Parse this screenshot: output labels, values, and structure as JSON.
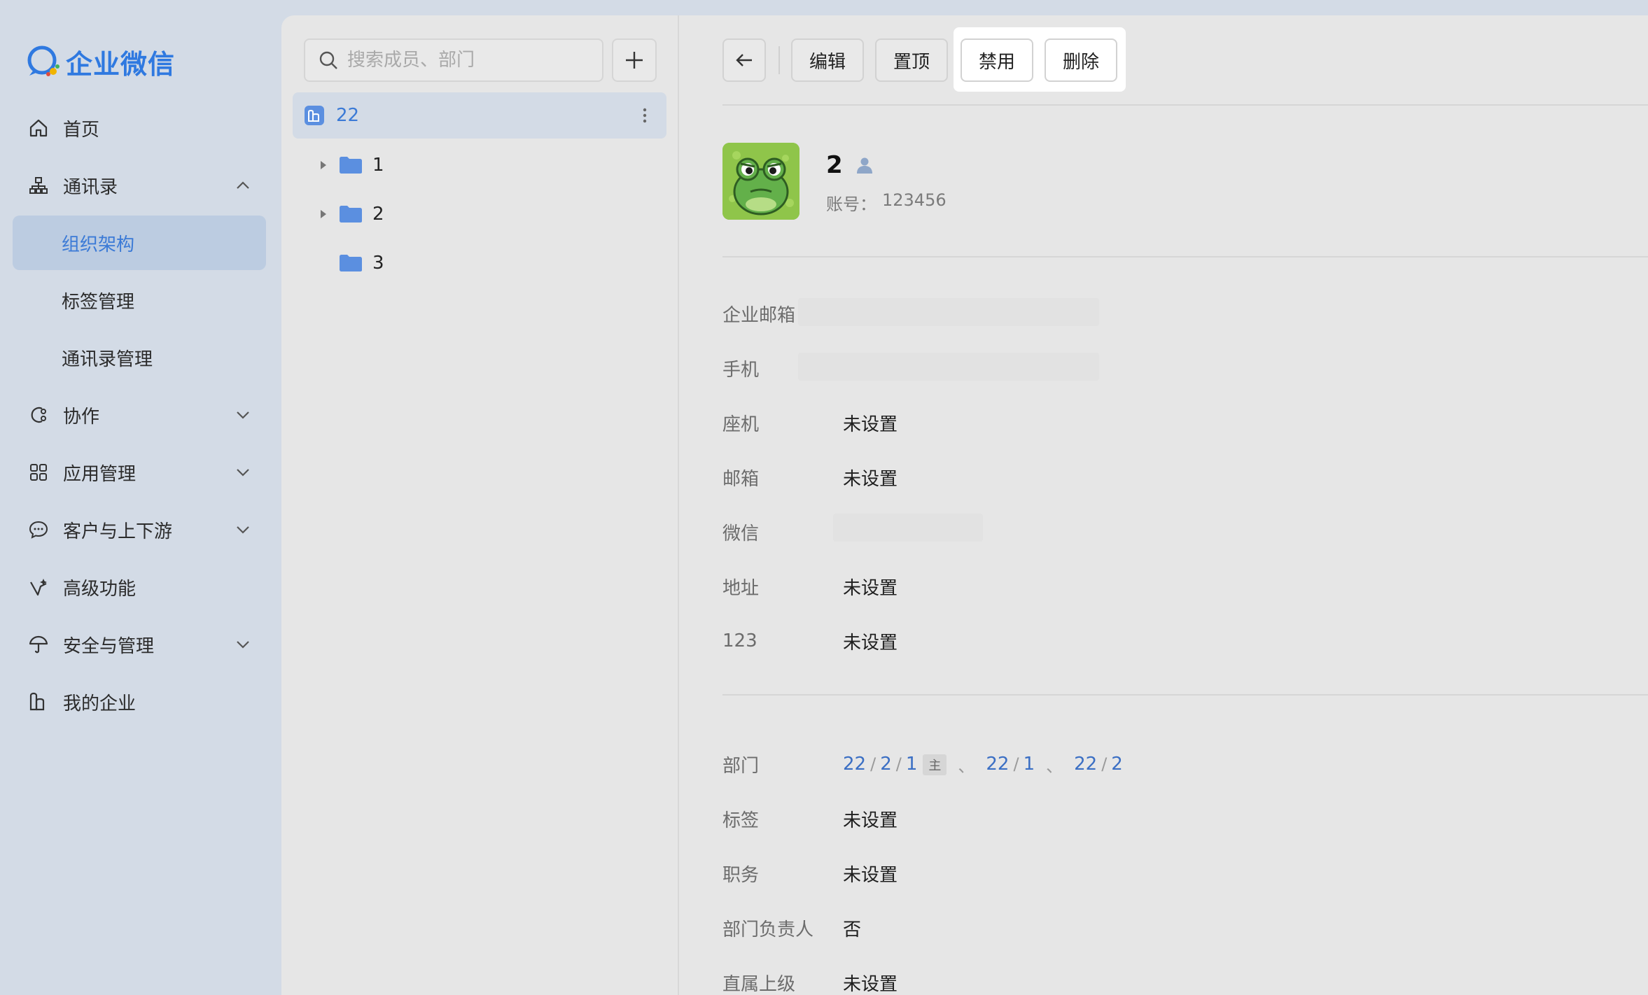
{
  "app": {
    "brand": "企业微信",
    "brand_color": "#2f79e0",
    "accent_color": "#3b7ad6"
  },
  "nav": {
    "home": "首页",
    "contacts": "通讯录",
    "contacts_sub": {
      "org": "组织架构",
      "tags": "标签管理",
      "manage": "通讯录管理"
    },
    "collab": "协作",
    "apps": "应用管理",
    "customers": "客户与上下游",
    "advanced": "高级功能",
    "security": "安全与管理",
    "my_company": "我的企业"
  },
  "dept_panel": {
    "search_placeholder": "搜索成员、部门",
    "root": "22",
    "children": [
      "1",
      "2",
      "3"
    ]
  },
  "toolbar": {
    "edit": "编辑",
    "pin": "置顶",
    "disable": "禁用",
    "delete": "删除"
  },
  "profile": {
    "name": "2",
    "account_label": "账号：",
    "account_value": "123456"
  },
  "fields": {
    "email_corp": "企业邮箱",
    "mobile": "手机",
    "landline": {
      "label": "座机",
      "value": "未设置"
    },
    "mailbox": {
      "label": "邮箱",
      "value": "未设置"
    },
    "wechat": "微信",
    "address": {
      "label": "地址",
      "value": "未设置"
    },
    "custom": {
      "label": "123",
      "value": "未设置"
    }
  },
  "org_fields": {
    "dept_label": "部门",
    "dept_paths": [
      {
        "parts": [
          "22",
          "2",
          "1"
        ],
        "main_tag": "主"
      },
      {
        "parts": [
          "22",
          "1"
        ]
      },
      {
        "parts": [
          "22",
          "2"
        ]
      }
    ],
    "path_sep": "/",
    "list_sep": "、",
    "tags": {
      "label": "标签",
      "value": "未设置"
    },
    "title": {
      "label": "职务",
      "value": "未设置"
    },
    "leader": {
      "label": "部门负责人",
      "value": "否"
    },
    "manager": {
      "label": "直属上级",
      "value": "未设置"
    }
  }
}
